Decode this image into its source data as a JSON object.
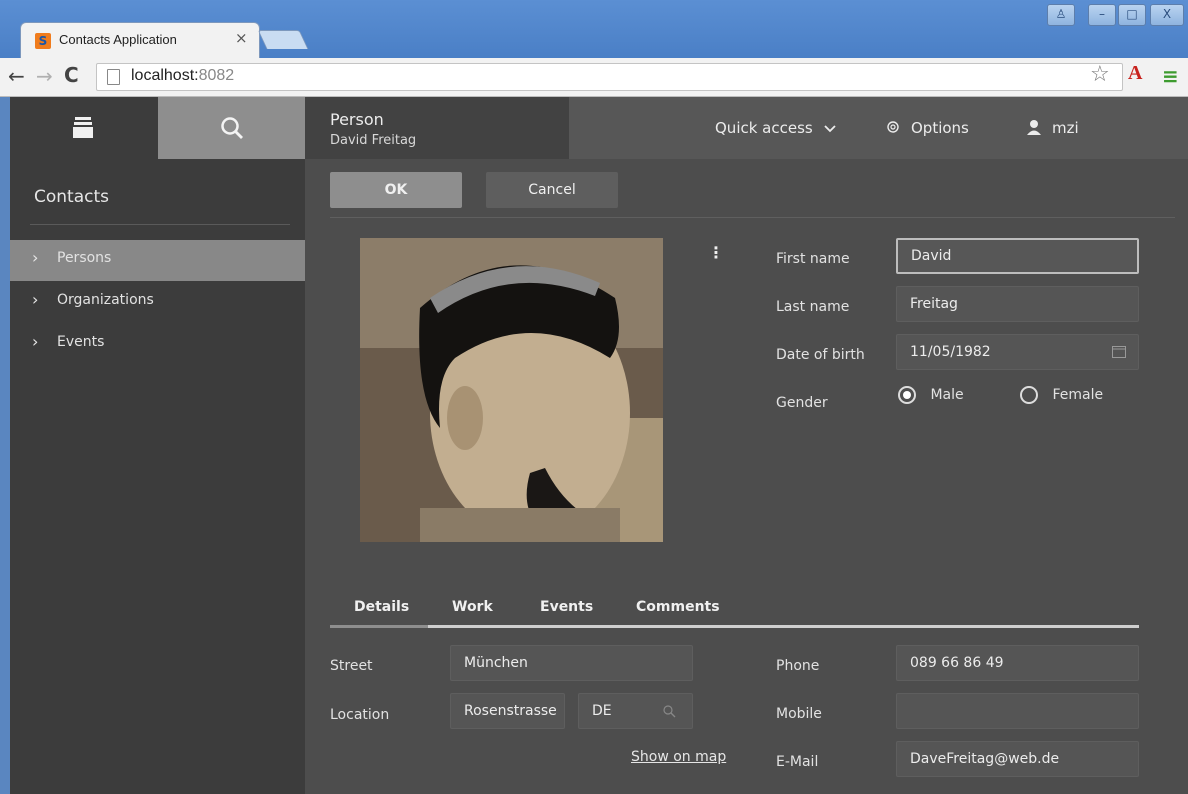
{
  "browser": {
    "tab_title": "Contacts Application",
    "tab_close": "×",
    "favicon": "S",
    "url_host": "localhost:",
    "url_port": "8082",
    "back": "←",
    "forward": "→",
    "reload": "C",
    "star": "☆",
    "acrobat": "A",
    "menu": "≡",
    "win_user": "♙",
    "win_min": "–",
    "win_max": "□",
    "win_close": "X"
  },
  "sidebar": {
    "title": "Contacts",
    "items": [
      {
        "chevron": "›",
        "label": "Persons",
        "selected": true
      },
      {
        "chevron": "›",
        "label": "Organizations",
        "selected": false
      },
      {
        "chevron": "›",
        "label": "Events",
        "selected": false
      }
    ],
    "search_icon": "search-icon",
    "book_icon": "book-icon"
  },
  "header": {
    "type": "Person",
    "subtitle": "David Freitag",
    "quick_access": "Quick access",
    "options": "Options",
    "user": "mzi"
  },
  "actions": {
    "ok": "OK",
    "cancel": "Cancel"
  },
  "person": {
    "first_name_label": "First name",
    "first_name": "David",
    "last_name_label": "Last name",
    "last_name": "Freitag",
    "dob_label": "Date of birth",
    "dob": "11/05/1982",
    "gender_label": "Gender",
    "gender_male": "Male",
    "gender_female": "Female",
    "gender_selected": "Male",
    "more_icon": "⋮"
  },
  "tabs": [
    "Details",
    "Work",
    "Events",
    "Comments"
  ],
  "details": {
    "street_label": "Street",
    "street": "München",
    "location_label": "Location",
    "location_city": "Rosenstrasse",
    "location_country": "DE",
    "show_on_map": "Show on map",
    "phone_label": "Phone",
    "phone": "089 66 86 49",
    "mobile_label": "Mobile",
    "mobile": "",
    "email_label": "E-Mail",
    "email": "DaveFreitag@web.de"
  },
  "colors": {
    "accent": "#8e8e8e",
    "bg": "#4b4b4b",
    "sidebar": "#3c3c3c",
    "chrome": "#4a7fc6"
  }
}
